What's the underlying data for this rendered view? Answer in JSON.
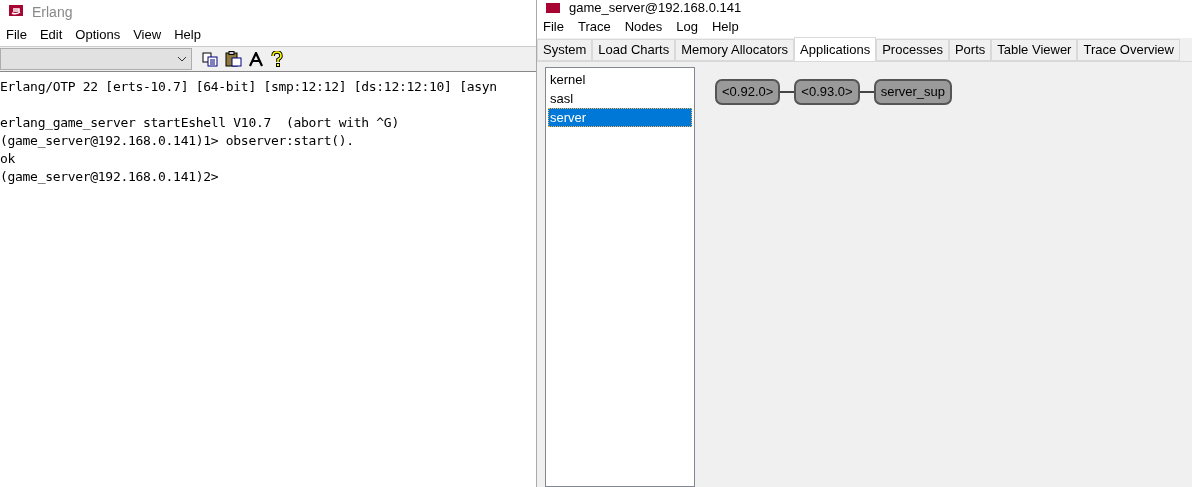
{
  "shell_window": {
    "title": "Erlang",
    "menu": [
      "File",
      "Edit",
      "Options",
      "View",
      "Help"
    ],
    "banner": "Erlang/OTP 22 [erts-10.7] [64-bit] [smp:12:12] [ds:12:12:10] [asyn",
    "terminal_lines": [
      "erlang_game_server startEshell V10.7  (abort with ^G)",
      "(game_server@192.168.0.141)1> observer:start().",
      "ok",
      "(game_server@192.168.0.141)2>"
    ]
  },
  "observer_window": {
    "title": "game_server@192.168.0.141",
    "menu": [
      "File",
      "Trace",
      "Nodes",
      "Log",
      "Help"
    ],
    "tabs": [
      {
        "label": "System",
        "selected": false
      },
      {
        "label": "Load Charts",
        "selected": false
      },
      {
        "label": "Memory Allocators",
        "selected": false
      },
      {
        "label": "Applications",
        "selected": true
      },
      {
        "label": "Processes",
        "selected": false
      },
      {
        "label": "Ports",
        "selected": false
      },
      {
        "label": "Table Viewer",
        "selected": false
      },
      {
        "label": "Trace Overview",
        "selected": false
      }
    ],
    "applications": [
      {
        "name": "kernel",
        "selected": false
      },
      {
        "name": "sasl",
        "selected": false
      },
      {
        "name": "server",
        "selected": true
      }
    ],
    "process_tree": [
      "<0.92.0>",
      "<0.93.0>",
      "server_sup"
    ]
  }
}
